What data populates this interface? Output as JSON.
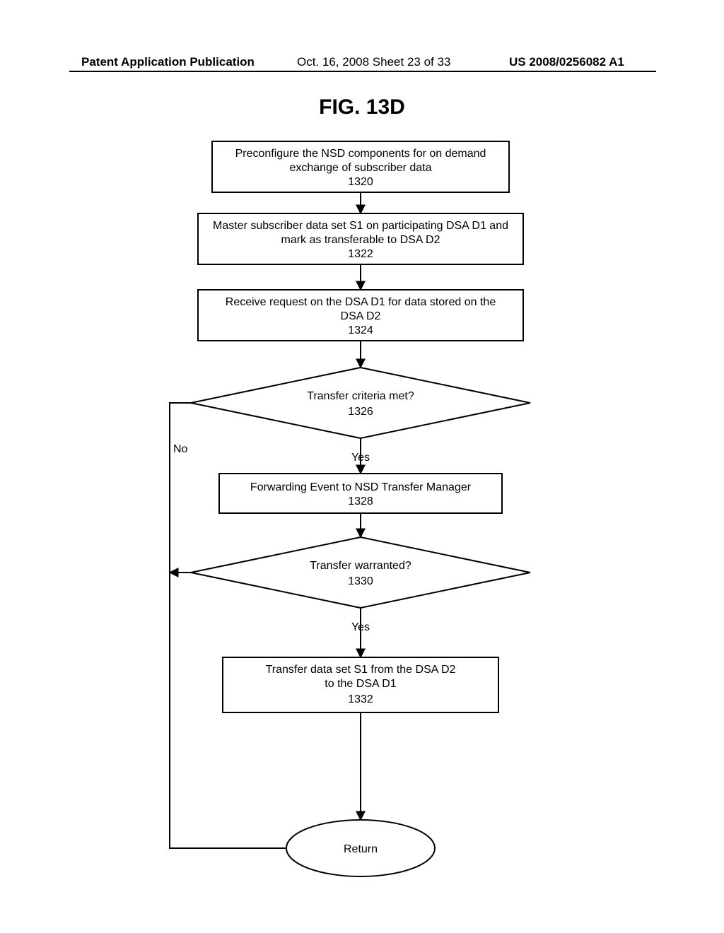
{
  "header": {
    "left": "Patent Application Publication",
    "mid": "Oct. 16, 2008  Sheet 23 of 33",
    "right": "US 2008/0256082 A1"
  },
  "figure_title": "FIG. 13D",
  "steps": {
    "s1320_l1": "Preconfigure the NSD components for on demand",
    "s1320_l2": "exchange of subscriber data",
    "s1320_num": "1320",
    "s1322_l1": "Master subscriber data set S1 on participating DSA D1 and",
    "s1322_l2": "mark as transferable to DSA D2",
    "s1322_num": "1322",
    "s1324_l1": "Receive request on the DSA D1 for data stored on the",
    "s1324_l2": "DSA D2",
    "s1324_num": "1324",
    "s1326_l1": "Transfer  criteria met?",
    "s1326_num": "1326",
    "s1328_l1": "Forwarding Event to NSD Transfer Manager",
    "s1328_num": "1328",
    "s1330_l1": "Transfer  warranted?",
    "s1330_num": "1330",
    "s1332_l1": "Transfer data set S1 from the DSA D2",
    "s1332_l2": "to the DSA D1",
    "s1332_num": "1332",
    "return": "Return"
  },
  "labels": {
    "no": "No",
    "yes": "Yes"
  }
}
